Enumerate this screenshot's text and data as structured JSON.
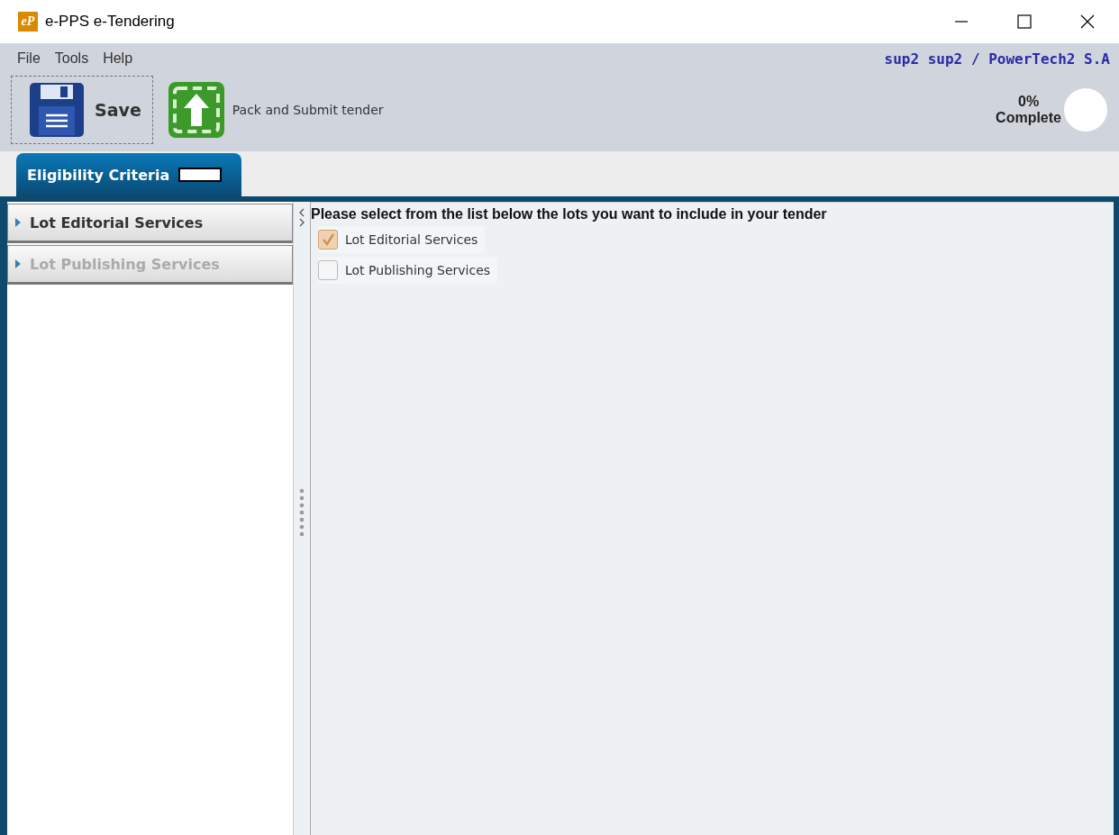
{
  "window": {
    "title": "e-PPS e-Tendering",
    "logo": "eP"
  },
  "menu": [
    "File",
    "Tools",
    "Help"
  ],
  "user": "sup2 sup2 / PowerTech2 S.A",
  "toolbar": {
    "save": "Save",
    "submit": "Pack and Submit tender"
  },
  "progress": {
    "percent": "0%",
    "label": "Complete"
  },
  "tabs": [
    {
      "label": "Eligibility Criteria",
      "selected": true
    }
  ],
  "sidebar": {
    "items": [
      {
        "label": "Lot Editorial Services",
        "disabled": false
      },
      {
        "label": "Lot Publishing Services",
        "disabled": true
      }
    ]
  },
  "content": {
    "instruction": "Please select from the list below the lots you want to include in your tender",
    "lots": [
      {
        "label": "Lot Editorial Services",
        "checked": true
      },
      {
        "label": "Lot Publishing Services",
        "checked": false
      }
    ]
  }
}
